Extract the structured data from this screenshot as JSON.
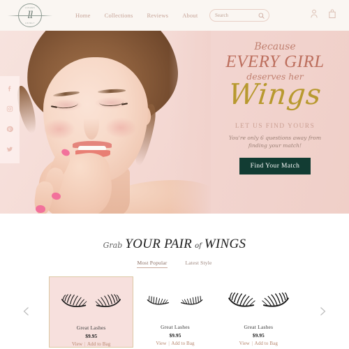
{
  "header": {
    "logo": {
      "monogram": "ll",
      "arc_top": "LASHES",
      "arc_bottom": "LOVELY"
    },
    "nav": [
      {
        "label": "Home"
      },
      {
        "label": "Collections"
      },
      {
        "label": "Reviews"
      },
      {
        "label": "About"
      }
    ],
    "search": {
      "placeholder": "Search",
      "value": "",
      "icon": "search-icon"
    },
    "actions": [
      {
        "icon": "account-icon"
      },
      {
        "icon": "shopping-bag-icon"
      }
    ]
  },
  "social": [
    {
      "icon": "facebook-icon",
      "label": "Facebook"
    },
    {
      "icon": "instagram-icon",
      "label": "Instagram"
    },
    {
      "icon": "pinterest-icon",
      "label": "Pinterest"
    },
    {
      "icon": "twitter-icon",
      "label": "Twitter"
    }
  ],
  "hero": {
    "line1": "Because",
    "line2": "EVERY GIRL",
    "line3": "deserves her",
    "line4": "Wings",
    "eyebrow": "LET US FIND YOURS",
    "subtitle_line1": "You're only 6 questions away from",
    "subtitle_line2": "finding  your match!",
    "cta_label": "Find Your Match"
  },
  "products_section": {
    "title_grab": "Grab",
    "title_main1": "YOUR PAIR",
    "title_of": "of",
    "title_main2": "WINGS",
    "tabs": [
      {
        "label": "Most Popular",
        "active": true
      },
      {
        "label": "Latest Style",
        "active": false
      }
    ],
    "prev_arrow": "chevron-left-icon",
    "next_arrow": "chevron-right-icon",
    "view_label": "View",
    "separator": "|",
    "add_label": "Add to Bag",
    "items": [
      {
        "name": "Great Lashes",
        "price": "$9.95",
        "featured": true,
        "style": "wispy-volume"
      },
      {
        "name": "Great Lashes",
        "price": "$9.95",
        "featured": false,
        "style": "natural-spiky"
      },
      {
        "name": "Great Lashes",
        "price": "$9.95",
        "featured": false,
        "style": "dramatic-fluffy"
      }
    ]
  },
  "colors": {
    "header_bg": "#faf6f2",
    "nav_text": "#c5a296",
    "hero_bg": "#f2d5d0",
    "hero_accent": "#bc6e5d",
    "wings_gold": "#b8992f",
    "cta_bg": "#123c33",
    "featured_card_bg": "#f7e0dd",
    "featured_card_border": "#dcc9a4",
    "price_text": "#1f1f1f",
    "action_link": "#b4836a"
  }
}
